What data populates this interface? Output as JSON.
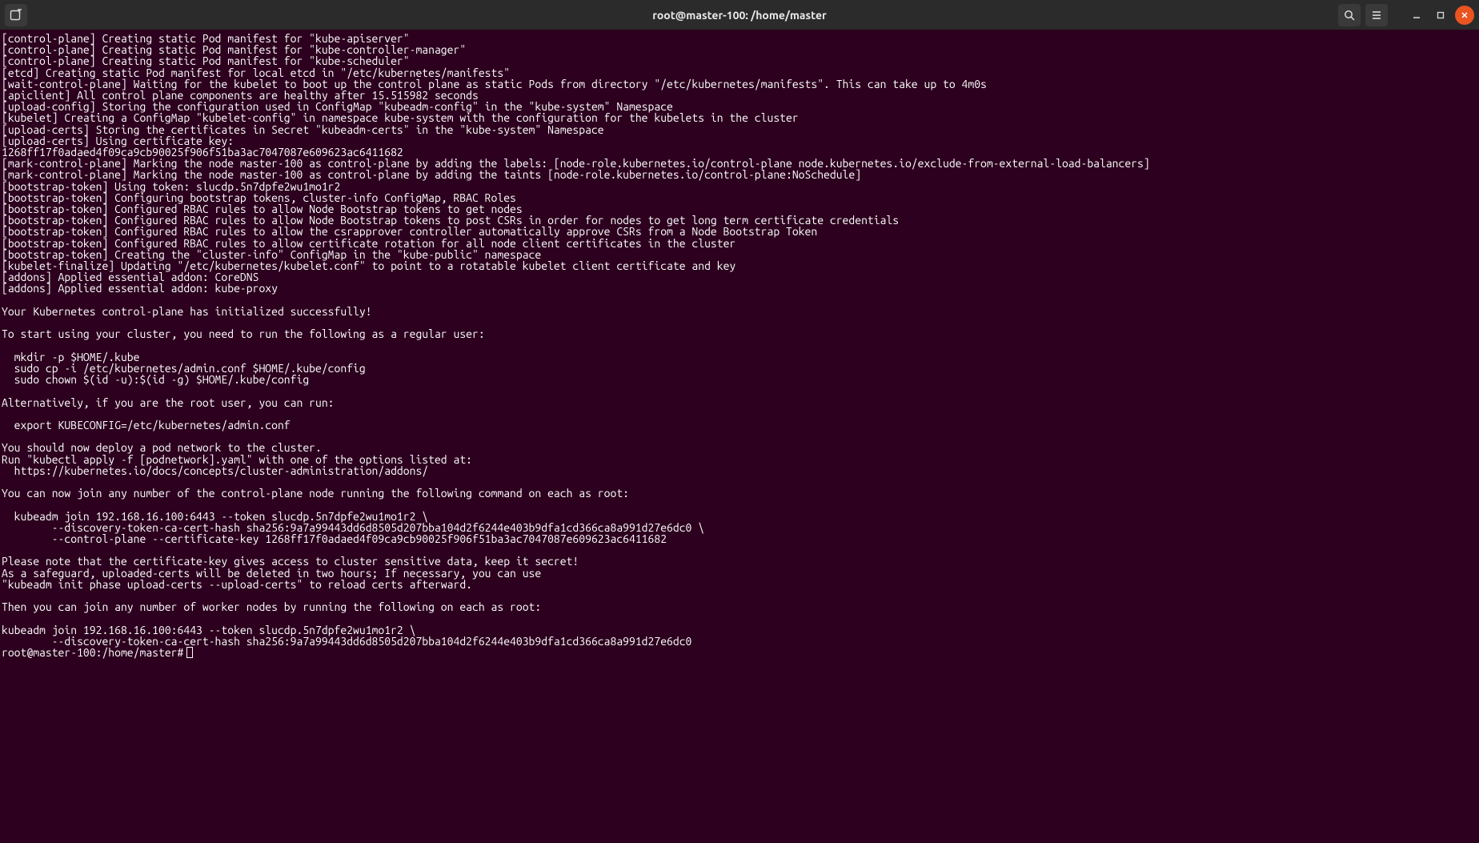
{
  "titlebar": {
    "title": "root@master-100: /home/master"
  },
  "terminal": {
    "lines": [
      "[control-plane] Creating static Pod manifest for \"kube-apiserver\"",
      "[control-plane] Creating static Pod manifest for \"kube-controller-manager\"",
      "[control-plane] Creating static Pod manifest for \"kube-scheduler\"",
      "[etcd] Creating static Pod manifest for local etcd in \"/etc/kubernetes/manifests\"",
      "[wait-control-plane] Waiting for the kubelet to boot up the control plane as static Pods from directory \"/etc/kubernetes/manifests\". This can take up to 4m0s",
      "[apiclient] All control plane components are healthy after 15.515982 seconds",
      "[upload-config] Storing the configuration used in ConfigMap \"kubeadm-config\" in the \"kube-system\" Namespace",
      "[kubelet] Creating a ConfigMap \"kubelet-config\" in namespace kube-system with the configuration for the kubelets in the cluster",
      "[upload-certs] Storing the certificates in Secret \"kubeadm-certs\" in the \"kube-system\" Namespace",
      "[upload-certs] Using certificate key:",
      "1268ff17f0adaed4f09ca9cb90025f906f51ba3ac7047087e609623ac6411682",
      "[mark-control-plane] Marking the node master-100 as control-plane by adding the labels: [node-role.kubernetes.io/control-plane node.kubernetes.io/exclude-from-external-load-balancers]",
      "[mark-control-plane] Marking the node master-100 as control-plane by adding the taints [node-role.kubernetes.io/control-plane:NoSchedule]",
      "[bootstrap-token] Using token: slucdp.5n7dpfe2wu1mo1r2",
      "[bootstrap-token] Configuring bootstrap tokens, cluster-info ConfigMap, RBAC Roles",
      "[bootstrap-token] Configured RBAC rules to allow Node Bootstrap tokens to get nodes",
      "[bootstrap-token] Configured RBAC rules to allow Node Bootstrap tokens to post CSRs in order for nodes to get long term certificate credentials",
      "[bootstrap-token] Configured RBAC rules to allow the csrapprover controller automatically approve CSRs from a Node Bootstrap Token",
      "[bootstrap-token] Configured RBAC rules to allow certificate rotation for all node client certificates in the cluster",
      "[bootstrap-token] Creating the \"cluster-info\" ConfigMap in the \"kube-public\" namespace",
      "[kubelet-finalize] Updating \"/etc/kubernetes/kubelet.conf\" to point to a rotatable kubelet client certificate and key",
      "[addons] Applied essential addon: CoreDNS",
      "[addons] Applied essential addon: kube-proxy",
      "",
      "Your Kubernetes control-plane has initialized successfully!",
      "",
      "To start using your cluster, you need to run the following as a regular user:",
      "",
      "  mkdir -p $HOME/.kube",
      "  sudo cp -i /etc/kubernetes/admin.conf $HOME/.kube/config",
      "  sudo chown $(id -u):$(id -g) $HOME/.kube/config",
      "",
      "Alternatively, if you are the root user, you can run:",
      "",
      "  export KUBECONFIG=/etc/kubernetes/admin.conf",
      "",
      "You should now deploy a pod network to the cluster.",
      "Run \"kubectl apply -f [podnetwork].yaml\" with one of the options listed at:",
      "  https://kubernetes.io/docs/concepts/cluster-administration/addons/",
      "",
      "You can now join any number of the control-plane node running the following command on each as root:",
      "",
      "  kubeadm join 192.168.16.100:6443 --token slucdp.5n7dpfe2wu1mo1r2 \\",
      "        --discovery-token-ca-cert-hash sha256:9a7a99443dd6d8505d207bba104d2f6244e403b9dfa1cd366ca8a991d27e6dc0 \\",
      "        --control-plane --certificate-key 1268ff17f0adaed4f09ca9cb90025f906f51ba3ac7047087e609623ac6411682",
      "",
      "Please note that the certificate-key gives access to cluster sensitive data, keep it secret!",
      "As a safeguard, uploaded-certs will be deleted in two hours; If necessary, you can use",
      "\"kubeadm init phase upload-certs --upload-certs\" to reload certs afterward.",
      "",
      "Then you can join any number of worker nodes by running the following on each as root:",
      "",
      "kubeadm join 192.168.16.100:6443 --token slucdp.5n7dpfe2wu1mo1r2 \\",
      "        --discovery-token-ca-cert-hash sha256:9a7a99443dd6d8505d207bba104d2f6244e403b9dfa1cd366ca8a991d27e6dc0"
    ],
    "prompt": "root@master-100:/home/master#"
  }
}
